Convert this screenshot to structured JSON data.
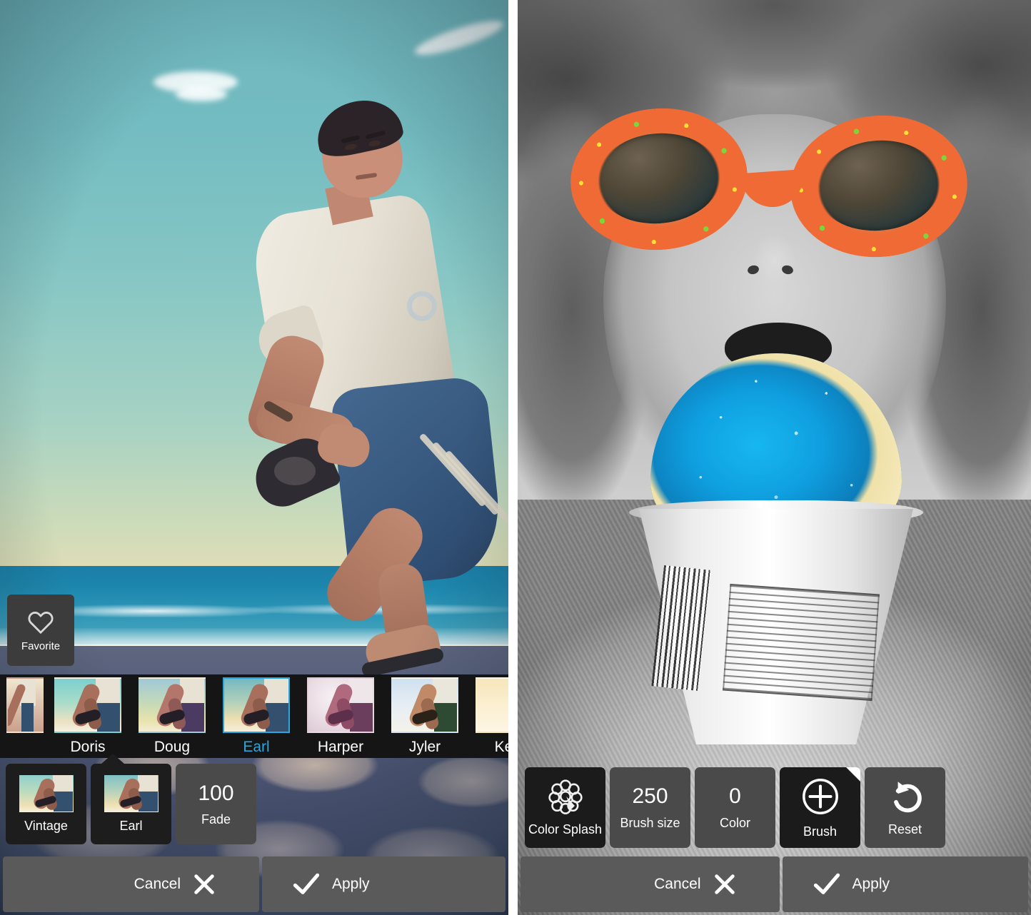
{
  "left_panel": {
    "name": "photo-filter-editor",
    "favorite": {
      "label": "Favorite",
      "icon": "heart-icon"
    },
    "filters": [
      {
        "name": "",
        "selected": false,
        "partial": true
      },
      {
        "name": "Doris",
        "selected": false
      },
      {
        "name": "Doug",
        "selected": false
      },
      {
        "name": "Earl",
        "selected": true
      },
      {
        "name": "Harper",
        "selected": false
      },
      {
        "name": "Jyler",
        "selected": false
      },
      {
        "name": "Kevi",
        "selected": false,
        "truncated": true
      }
    ],
    "detail_row": [
      {
        "label": "Vintage",
        "type": "category-thumb"
      },
      {
        "label": "Earl",
        "type": "filter-thumb"
      },
      {
        "label": "Fade",
        "type": "value",
        "value": "100"
      }
    ],
    "actions": {
      "cancel_label": "Cancel",
      "cancel_icon": "close-x-icon",
      "apply_label": "Apply",
      "apply_icon": "check-icon"
    }
  },
  "right_panel": {
    "name": "color-splash-editor",
    "tools": [
      {
        "label": "Color Splash",
        "icon": "flower-icon",
        "active": true,
        "value": ""
      },
      {
        "label": "Brush size",
        "value": "250",
        "active": false
      },
      {
        "label": "Color",
        "value": "0",
        "active": false
      },
      {
        "label": "Brush",
        "icon": "plus-circle-icon",
        "active": true,
        "badge": "corner-triangle"
      },
      {
        "label": "Reset",
        "icon": "undo-arrow-icon",
        "active": false
      }
    ],
    "actions": {
      "cancel_label": "Cancel",
      "cancel_icon": "close-x-icon",
      "apply_label": "Apply",
      "apply_icon": "check-icon"
    }
  },
  "colors": {
    "accent": "#29a8e0",
    "panel_dark": "#1d1d1d",
    "panel_mid": "#4a4a4a",
    "action_bar": "#5a5a5a",
    "strip_bg": "#151515",
    "text": "#ffffff",
    "splash_blue": "#17b7f0",
    "glasses_orange": "#ef6a35",
    "glasses_green": "#7fd43a",
    "glasses_yellow": "#ffe033"
  }
}
